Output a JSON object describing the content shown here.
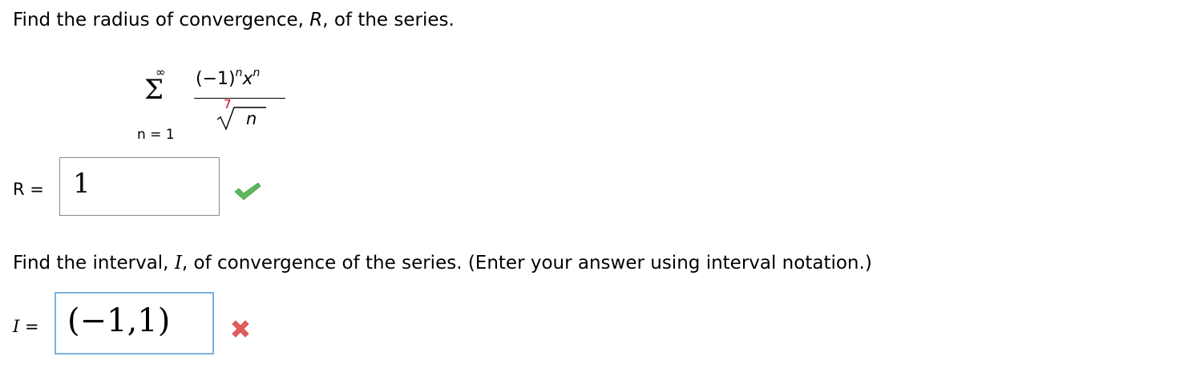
{
  "question1": {
    "prefix": "Find the radius of convergence, ",
    "var": "R",
    "suffix": ", of the series."
  },
  "formula": {
    "sum_upper": "∞",
    "sum_symbol": "Σ",
    "sum_lower": "n = 1",
    "numerator_base": "(−1)",
    "numerator_exp1": "n",
    "numerator_x": "x",
    "numerator_exp2": "n",
    "root_index": "7",
    "radicand": "n"
  },
  "answer_r": {
    "label_var": "R",
    "label_eq": " =",
    "value": "1",
    "status": "correct",
    "status_color": "#5cb85c"
  },
  "question2": {
    "prefix": "Find the interval, ",
    "var": "I",
    "suffix": ", of convergence of the series. (Enter your answer using interval notation.)"
  },
  "answer_i": {
    "label_var": "I",
    "label_eq": " =",
    "value": "(−1,1)",
    "status": "incorrect",
    "status_color": "#e35d5b"
  }
}
